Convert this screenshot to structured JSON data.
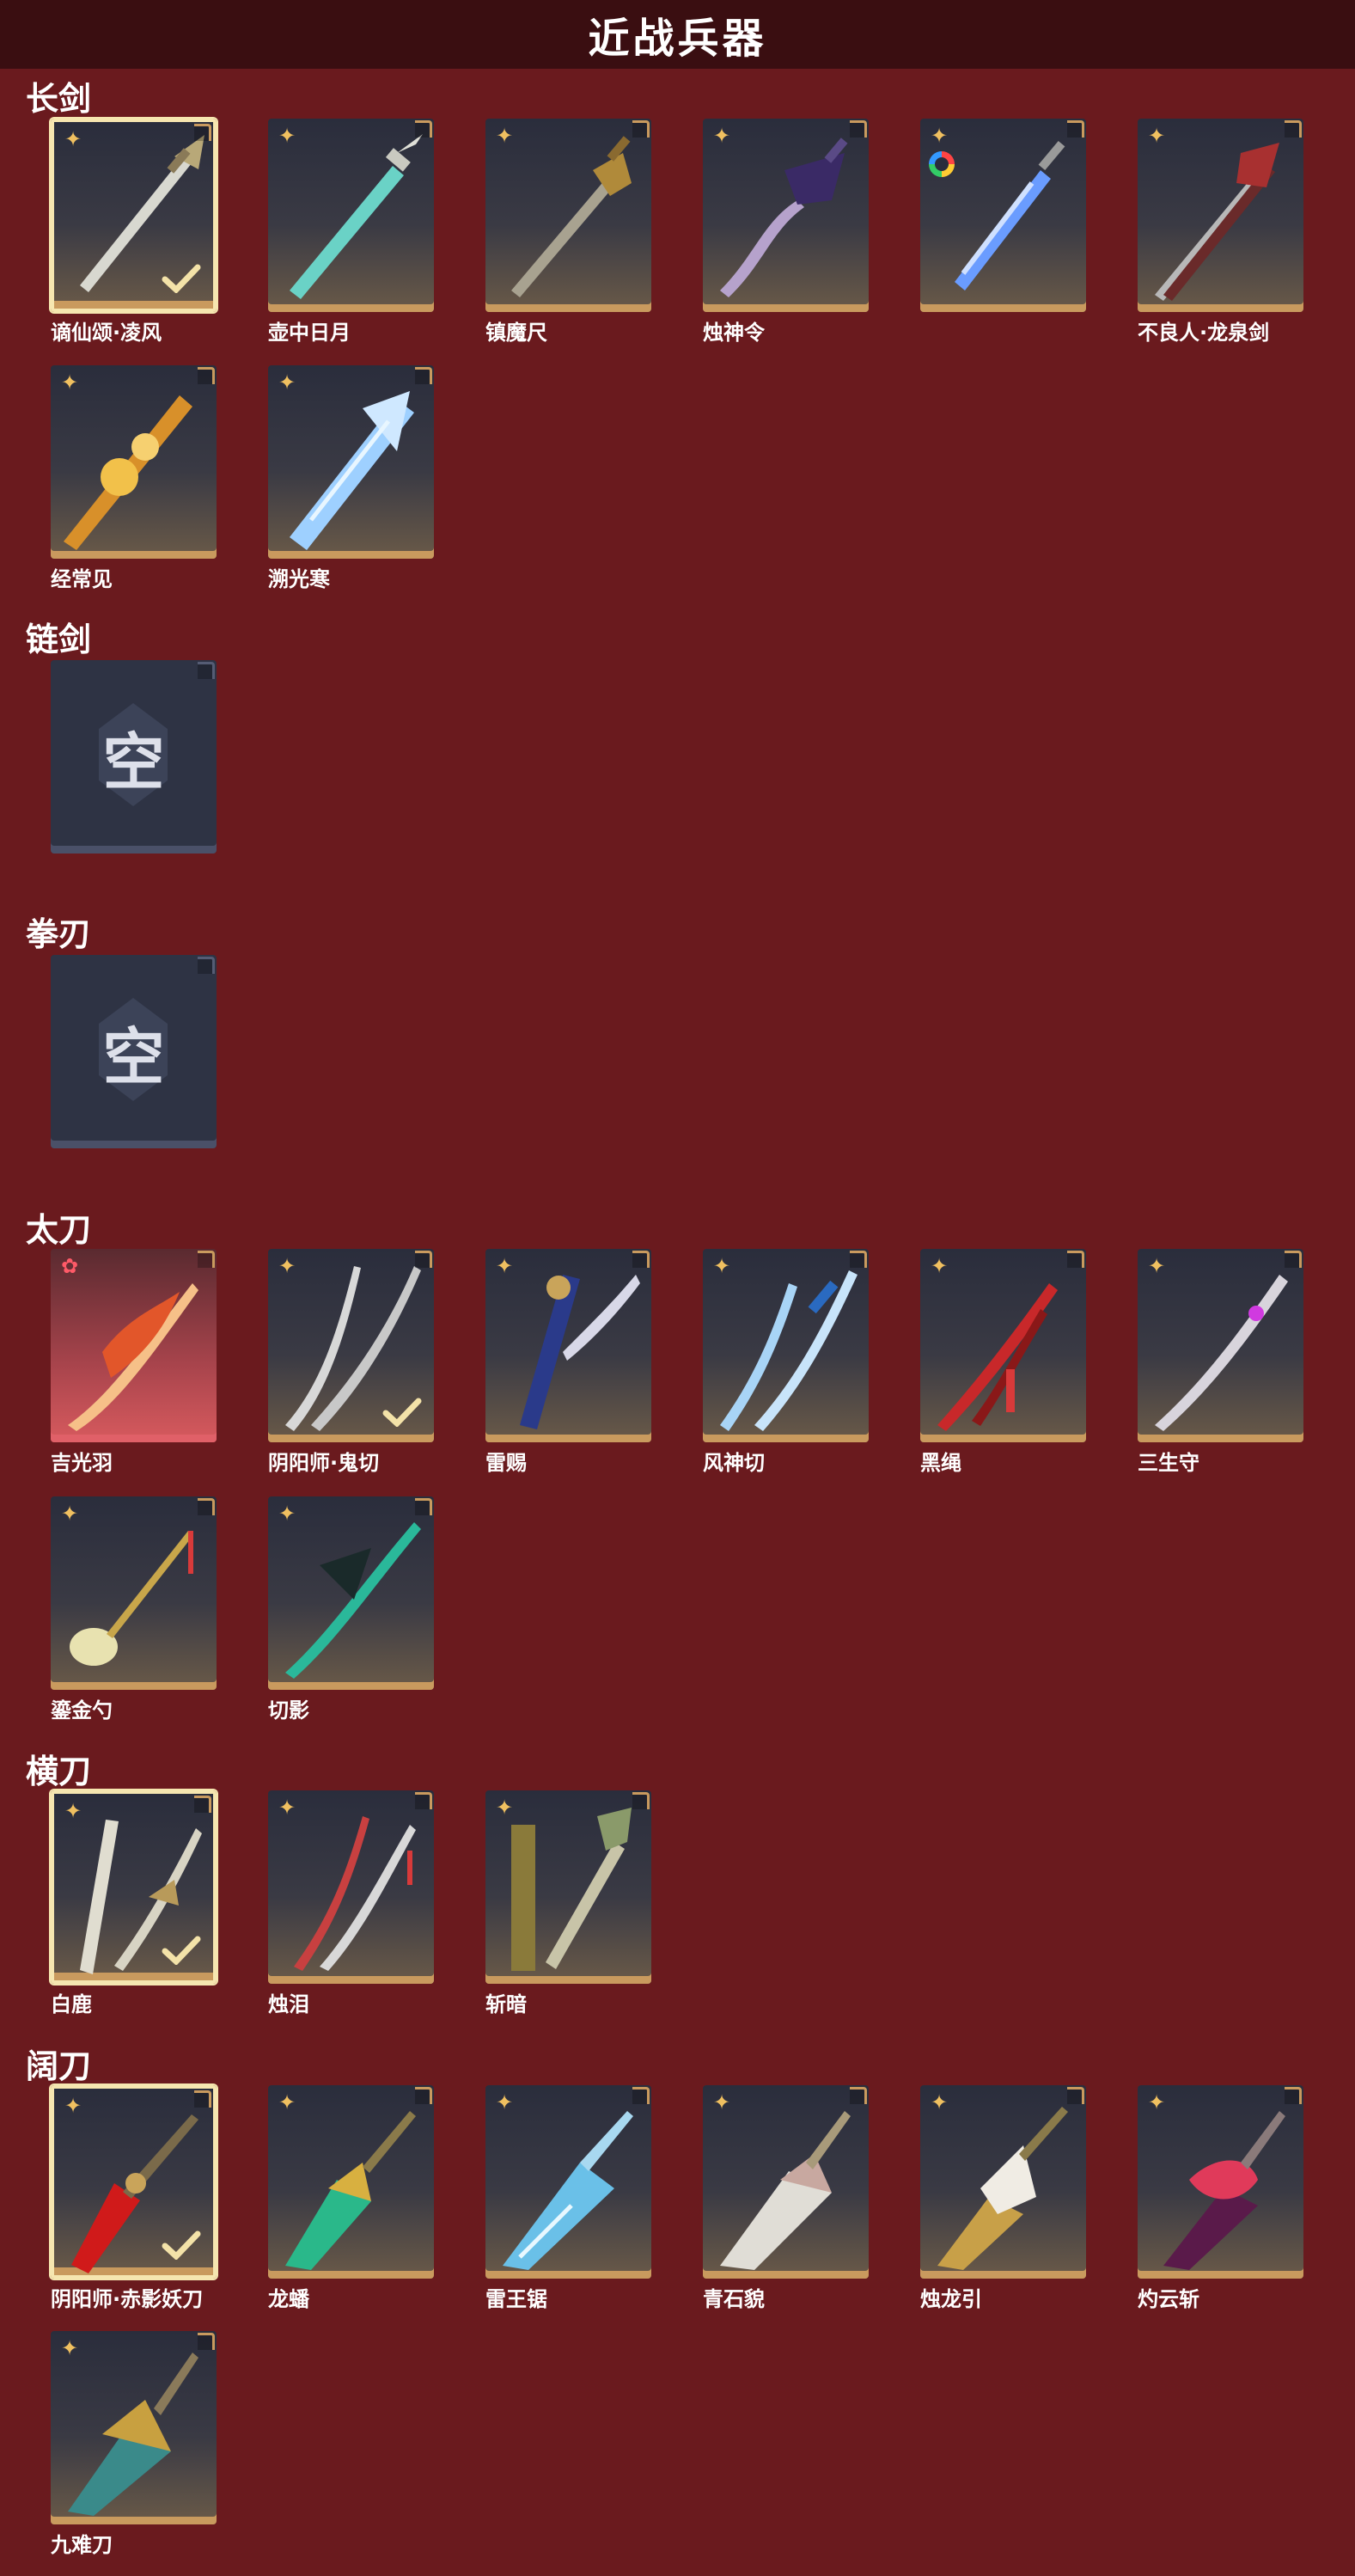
{
  "page_title": "近战兵器",
  "empty_label": "空",
  "sections": {
    "changjian": {
      "title": "长剑",
      "items": [
        "谪仙颂·凌风",
        "壶中日月",
        "镇魔尺",
        "烛神令",
        "",
        "不良人·龙泉剑",
        "经常见",
        "溯光寒"
      ]
    },
    "lianjian": {
      "title": "链剑"
    },
    "quandao": {
      "title": "拳刃"
    },
    "taidao": {
      "title": "太刀",
      "items": [
        "吉光羽",
        "阴阳师·鬼切",
        "雷赐",
        "风神切",
        "黑绳",
        "三生守",
        "鎏金勺",
        "切影"
      ]
    },
    "hengdao": {
      "title": "横刀",
      "items": [
        "白鹿",
        "烛泪",
        "斩暗"
      ]
    },
    "kuodao": {
      "title": "阔刀",
      "items": [
        "阴阳师·赤影妖刀",
        "龙蟠",
        "雷王锯",
        "青石貌",
        "烛龙引",
        "灼云斩",
        "九难刀"
      ]
    }
  },
  "colors": {
    "background": "#6a1a1e",
    "title_bar": "#3a0e11",
    "gold_accent": "#c99a5e",
    "selected_border": "#f6e6b0"
  }
}
